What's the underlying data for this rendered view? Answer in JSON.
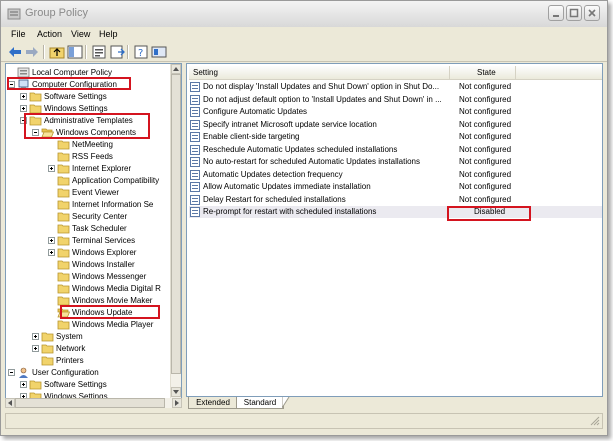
{
  "window": {
    "title": "Group Policy"
  },
  "menu": [
    "File",
    "Action",
    "View",
    "Help"
  ],
  "tree": {
    "items": [
      {
        "label": "Local Computer Policy",
        "level": 0,
        "icon": "policy-icon",
        "expander": "none"
      },
      {
        "label": "Computer Configuration",
        "level": 0,
        "icon": "computer-icon",
        "expander": "minus"
      },
      {
        "label": "Software Settings",
        "level": 1,
        "icon": "folder-icon",
        "expander": "plus"
      },
      {
        "label": "Windows Settings",
        "level": 1,
        "icon": "folder-icon",
        "expander": "plus"
      },
      {
        "label": "Administrative Templates",
        "level": 1,
        "icon": "folder-icon",
        "expander": "minus"
      },
      {
        "label": "Windows Components",
        "level": 2,
        "icon": "folder-open-icon",
        "expander": "minus"
      },
      {
        "label": "NetMeeting",
        "level": 3,
        "icon": "folder-icon",
        "expander": "none"
      },
      {
        "label": "RSS Feeds",
        "level": 3,
        "icon": "folder-icon",
        "expander": "none"
      },
      {
        "label": "Internet Explorer",
        "level": 3,
        "icon": "folder-icon",
        "expander": "plus"
      },
      {
        "label": "Application Compatibility",
        "level": 3,
        "icon": "folder-icon",
        "expander": "none"
      },
      {
        "label": "Event Viewer",
        "level": 3,
        "icon": "folder-icon",
        "expander": "none"
      },
      {
        "label": "Internet Information Se",
        "level": 3,
        "icon": "folder-icon",
        "expander": "none"
      },
      {
        "label": "Security Center",
        "level": 3,
        "icon": "folder-icon",
        "expander": "none"
      },
      {
        "label": "Task Scheduler",
        "level": 3,
        "icon": "folder-icon",
        "expander": "none"
      },
      {
        "label": "Terminal Services",
        "level": 3,
        "icon": "folder-icon",
        "expander": "plus"
      },
      {
        "label": "Windows Explorer",
        "level": 3,
        "icon": "folder-icon",
        "expander": "plus"
      },
      {
        "label": "Windows Installer",
        "level": 3,
        "icon": "folder-icon",
        "expander": "none"
      },
      {
        "label": "Windows Messenger",
        "level": 3,
        "icon": "folder-icon",
        "expander": "none"
      },
      {
        "label": "Windows Media Digital R",
        "level": 3,
        "icon": "folder-icon",
        "expander": "none"
      },
      {
        "label": "Windows Movie Maker",
        "level": 3,
        "icon": "folder-icon",
        "expander": "none"
      },
      {
        "label": "Windows Update",
        "level": 3,
        "icon": "folder-open-icon",
        "expander": "none"
      },
      {
        "label": "Windows Media Player",
        "level": 3,
        "icon": "folder-icon",
        "expander": "none"
      },
      {
        "label": "System",
        "level": 2,
        "icon": "folder-icon",
        "expander": "plus"
      },
      {
        "label": "Network",
        "level": 2,
        "icon": "folder-icon",
        "expander": "plus"
      },
      {
        "label": "Printers",
        "level": 2,
        "icon": "folder-icon",
        "expander": "none"
      },
      {
        "label": "User Configuration",
        "level": 0,
        "icon": "user-icon",
        "expander": "minus"
      },
      {
        "label": "Software Settings",
        "level": 1,
        "icon": "folder-icon",
        "expander": "plus"
      },
      {
        "label": "Windows Settings",
        "level": 1,
        "icon": "folder-icon",
        "expander": "plus"
      }
    ]
  },
  "list": {
    "columns": {
      "setting": "Setting",
      "state": "State"
    },
    "rows": [
      {
        "setting": "Do not display 'Install Updates and Shut Down' option in Shut Do...",
        "state": "Not configured"
      },
      {
        "setting": "Do not adjust default option to 'Install Updates and Shut Down' in ...",
        "state": "Not configured"
      },
      {
        "setting": "Configure Automatic Updates",
        "state": "Not configured"
      },
      {
        "setting": "Specify intranet Microsoft update service location",
        "state": "Not configured"
      },
      {
        "setting": "Enable client-side targeting",
        "state": "Not configured"
      },
      {
        "setting": "Reschedule Automatic Updates scheduled installations",
        "state": "Not configured"
      },
      {
        "setting": "No auto-restart for scheduled Automatic Updates installations",
        "state": "Not configured"
      },
      {
        "setting": "Automatic Updates detection frequency",
        "state": "Not configured"
      },
      {
        "setting": "Allow Automatic Updates immediate installation",
        "state": "Not configured"
      },
      {
        "setting": "Delay Restart for scheduled installations",
        "state": "Not configured"
      },
      {
        "setting": "Re-prompt for restart with scheduled installations",
        "state": "Disabled"
      }
    ]
  },
  "tabs": [
    "Extended",
    "Standard"
  ],
  "colors": {
    "highlight": "#d4141f",
    "paneBorder": "#7f9db9",
    "chrome": "#ece9d8"
  }
}
